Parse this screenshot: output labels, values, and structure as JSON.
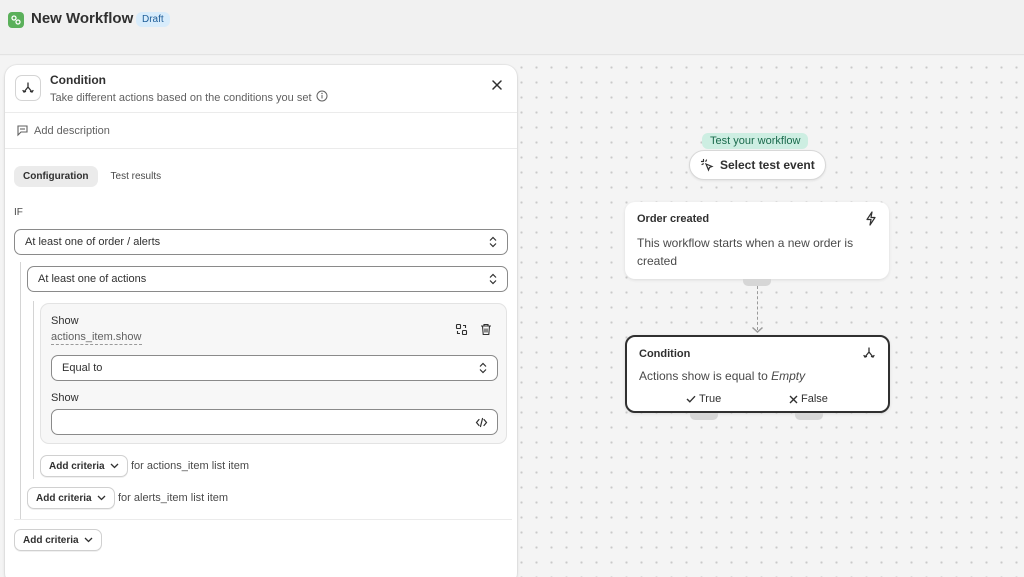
{
  "header": {
    "title": "New Workflow",
    "badge": "Draft"
  },
  "panel": {
    "title": "Condition",
    "subtitle": "Take different actions based on the conditions you set",
    "add_description": "Add description",
    "tabs": [
      {
        "label": "Configuration",
        "active": true
      },
      {
        "label": "Test results",
        "active": false
      }
    ],
    "if_label": "IF",
    "outer_select": "At least one of order / alerts",
    "inner_select": "At least one of actions",
    "criteria": {
      "field_name": "Show",
      "field_path": "actions_item.show",
      "operator": "Equal to",
      "value_label": "Show",
      "value": ""
    },
    "add_criteria_inner": {
      "label": "Add criteria",
      "for_text": "for actions_item list item"
    },
    "add_criteria_middle": {
      "label": "Add criteria",
      "for_text": "for alerts_item list item"
    },
    "add_criteria_outer": {
      "label": "Add criteria"
    }
  },
  "flow": {
    "test_tag": "Test your workflow",
    "select_event": "Select test event",
    "trigger": {
      "title": "Order created",
      "text": "This workflow starts when a new order is created"
    },
    "condition": {
      "title": "Condition",
      "text_prefix": "Actions show is equal to",
      "text_value": "Empty",
      "true_label": "True",
      "false_label": "False"
    }
  },
  "colors": {
    "draft_badge_bg": "#d8ecfb",
    "test_tag_bg": "#cdeee2",
    "app_icon": "#5bb05b"
  }
}
